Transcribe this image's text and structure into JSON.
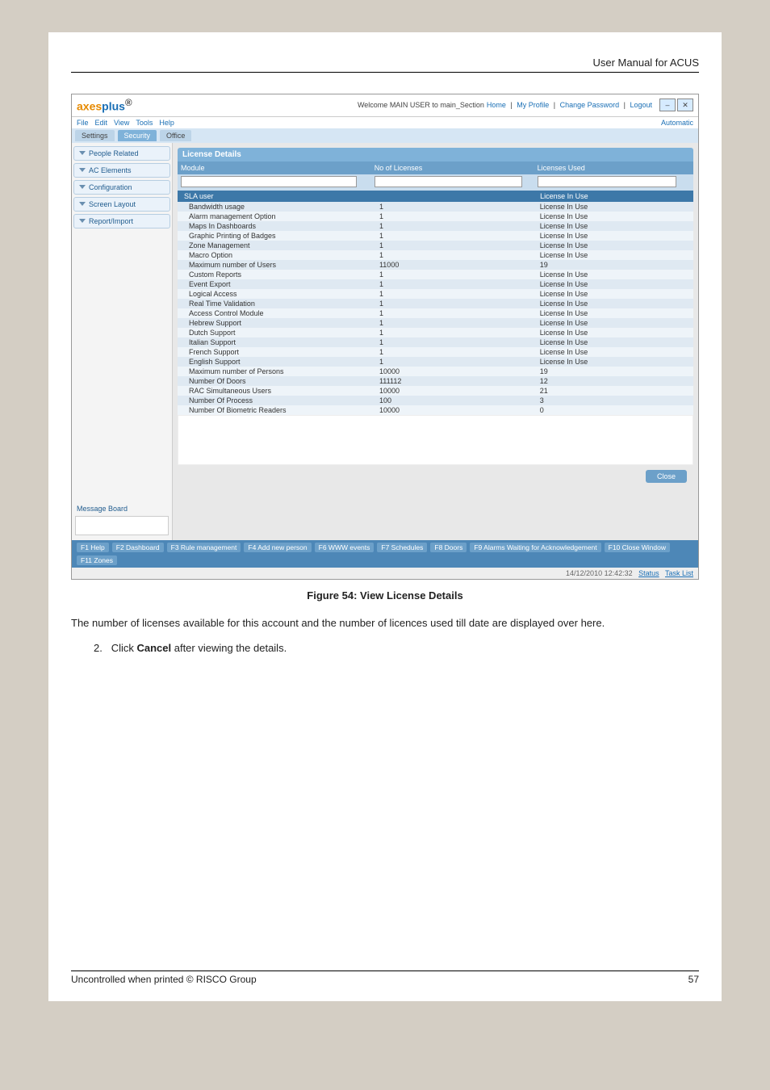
{
  "header": {
    "doc_title": "User Manual for ACUS"
  },
  "app": {
    "logo_left": "axes",
    "logo_right": "plus",
    "logo_sup": "®",
    "welcome": "Welcome MAIN USER to main_Section",
    "links": {
      "home": "Home",
      "profile": "My Profile",
      "changepw": "Change Password",
      "logout": "Logout"
    },
    "menu": [
      "File",
      "Edit",
      "View",
      "Tools",
      "Help"
    ],
    "menu_right": "Automatic",
    "tabs": [
      "Settings",
      "Security",
      "Office"
    ],
    "sidebar": {
      "items": [
        "People Related",
        "AC Elements",
        "Configuration",
        "Screen Layout",
        "Report/Import"
      ],
      "msgboard": "Message Board"
    },
    "panel": {
      "title": "License Details",
      "cols": {
        "c1": "Module",
        "c2": "No of Licenses",
        "c3": "Licenses Used"
      },
      "groupheads": {
        "g1": "SLA user",
        "g2": "License In Use"
      },
      "rows": [
        {
          "m": "Bandwidth usage",
          "n": "1",
          "u": "License In Use"
        },
        {
          "m": "Alarm management Option",
          "n": "1",
          "u": "License In Use"
        },
        {
          "m": "Maps In Dashboards",
          "n": "1",
          "u": "License In Use"
        },
        {
          "m": "Graphic Printing of Badges",
          "n": "1",
          "u": "License In Use"
        },
        {
          "m": "Zone Management",
          "n": "1",
          "u": "License In Use"
        },
        {
          "m": "Macro Option",
          "n": "1",
          "u": "License In Use"
        },
        {
          "m": "Maximum number of Users",
          "n": "11000",
          "u": "19"
        },
        {
          "m": "Custom Reports",
          "n": "1",
          "u": "License In Use"
        },
        {
          "m": "Event Export",
          "n": "1",
          "u": "License In Use"
        },
        {
          "m": "Logical Access",
          "n": "1",
          "u": "License In Use"
        },
        {
          "m": "Real Time Validation",
          "n": "1",
          "u": "License In Use"
        },
        {
          "m": "Access Control Module",
          "n": "1",
          "u": "License In Use"
        },
        {
          "m": "Hebrew Support",
          "n": "1",
          "u": "License In Use"
        },
        {
          "m": "Dutch Support",
          "n": "1",
          "u": "License In Use"
        },
        {
          "m": "Italian Support",
          "n": "1",
          "u": "License In Use"
        },
        {
          "m": "French Support",
          "n": "1",
          "u": "License In Use"
        },
        {
          "m": "English Support",
          "n": "1",
          "u": "License In Use"
        },
        {
          "m": "Maximum number of Persons",
          "n": "10000",
          "u": "19"
        },
        {
          "m": "Number Of Doors",
          "n": "111112",
          "u": "12"
        },
        {
          "m": "RAC Simultaneous Users",
          "n": "10000",
          "u": "21"
        },
        {
          "m": "Number Of Process",
          "n": "100",
          "u": "3"
        },
        {
          "m": "Number Of Biometric Readers",
          "n": "10000",
          "u": "0"
        }
      ],
      "close": "Close"
    },
    "fkeys": [
      "F1 Help",
      "F2 Dashboard",
      "F3 Rule management",
      "F4 Add new person",
      "F6 WWW events",
      "F7 Schedules",
      "F8 Doors",
      "F9 Alarms Waiting for Acknowledgement",
      "F10 Close Window",
      "F11 Zones"
    ],
    "status": {
      "time": "14/12/2010  12:42:32",
      "s1": "Status",
      "s2": "Task List"
    }
  },
  "caption": "Figure 54: View License Details",
  "body_text": "The number of licenses available for this account and the number of licences used till date are displayed over here.",
  "step": {
    "num": "2.",
    "text_pre": "Click ",
    "bold": "Cancel",
    "text_post": " after viewing the details."
  },
  "footer": {
    "left": "Uncontrolled when printed © RISCO Group",
    "right": "57"
  }
}
